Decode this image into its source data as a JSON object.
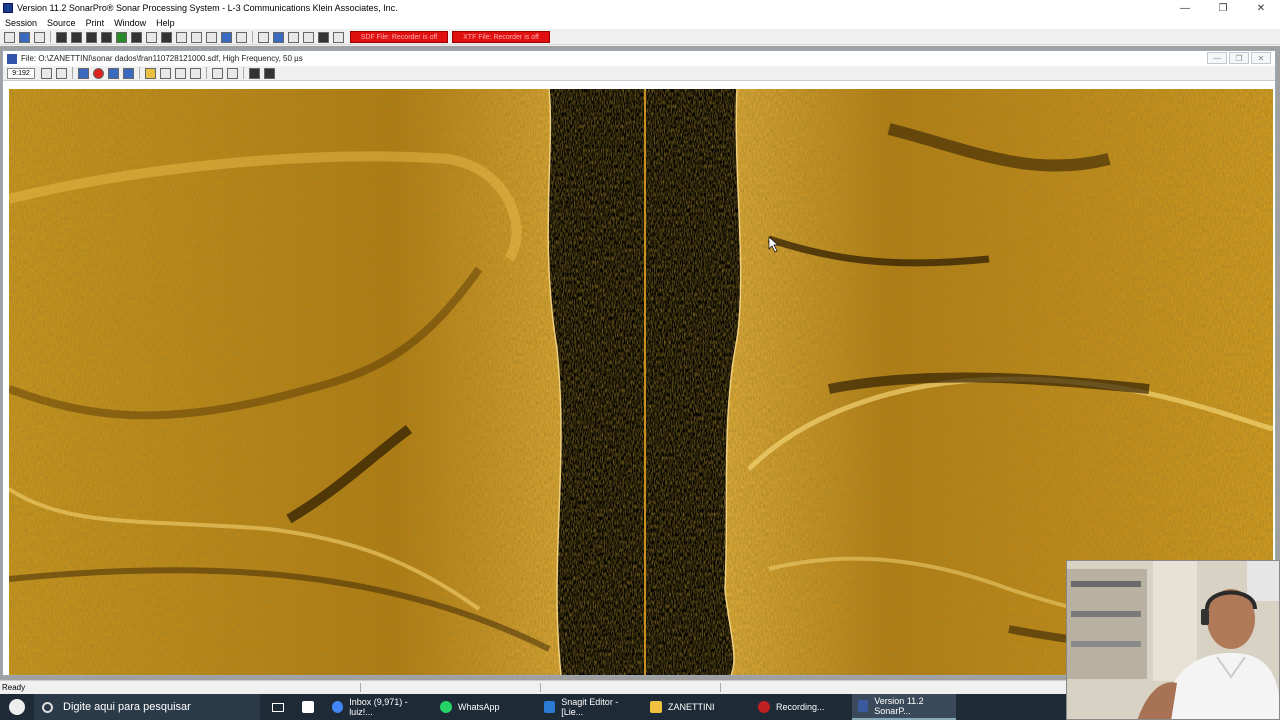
{
  "window": {
    "title": "Version 11.2 SonarPro® Sonar Processing System - L-3 Communications Klein Associates, Inc.",
    "minimize": "—",
    "restore": "❐",
    "close": "✕"
  },
  "menu": [
    "Session",
    "Source",
    "Print",
    "Window",
    "Help"
  ],
  "toolbar": {
    "sdf_badge": "SDF File: Recorder is off",
    "xtf_badge": "XTF File: Recorder is off"
  },
  "child": {
    "title": "File: O:\\ZANETTINI\\sonar dados\\fran110728121000.sdf, High Frequency, 50 µs",
    "time": "9:192"
  },
  "status": {
    "text": "Ready"
  },
  "taskbar": {
    "search_placeholder": "Digite aqui para pesquisar",
    "items": [
      {
        "label": "",
        "icon_color": "#ffffff"
      },
      {
        "label": "Inbox (9,971) - luiz!...",
        "icon_color": "#4285f4"
      },
      {
        "label": "WhatsApp",
        "icon_color": "#25d366"
      },
      {
        "label": "Snagit Editor - [Lie...",
        "icon_color": "#2a7ad4"
      },
      {
        "label": "ZANETTINI",
        "icon_color": "#f0c040"
      },
      {
        "label": "Recording...",
        "icon_color": "#c02020"
      },
      {
        "label": "Version 11.2 SonarP...",
        "icon_color": "#3a5aa0"
      }
    ]
  }
}
